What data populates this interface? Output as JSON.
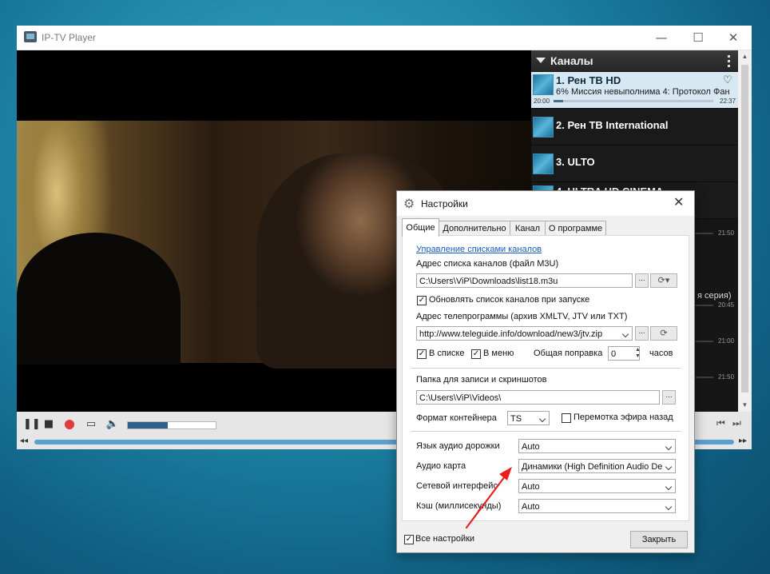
{
  "player": {
    "title": "IP-TV Player",
    "window_buttons": {
      "minimize": "—",
      "maximize": "☐",
      "close": "✕"
    },
    "logo_mark": "4"
  },
  "channels": {
    "header": "Каналы",
    "items": [
      {
        "name": "1. Рен ТВ HD",
        "program": "6% Миссия невыполнима 4: Протокол Фан...",
        "start": "20:00",
        "end": "22:37",
        "progress": 0.06
      },
      {
        "name": "2. Рен ТВ International"
      },
      {
        "name": "3. ULTO"
      },
      {
        "name": "4. ULTRA HD CINEMA"
      }
    ],
    "partial_text": "я серия)",
    "times": [
      "21:50",
      "20:45",
      "21:00",
      "21:50",
      "21:50"
    ]
  },
  "controls": {
    "volume": 0.45,
    "pause_icon": "❚❚",
    "stop_icon": "■",
    "folder_icon": "▭",
    "speaker_icon": "🔈"
  },
  "dialog": {
    "title": "Настройки",
    "tabs": [
      "Общие",
      "Дополнительно",
      "Канал",
      "О программе"
    ],
    "manage_link": "Управление списками каналов",
    "playlist_label": "Адрес списка каналов (файл M3U)",
    "playlist_value": "C:\\Users\\ViP\\Downloads\\list18.m3u",
    "update_on_start": "Обновлять список каналов при запуске",
    "epg_label": "Адрес телепрограммы (архив XMLTV, JTV или TXT)",
    "epg_value": "http://www.teleguide.info/download/new3/jtv.zip",
    "in_list": "В списке",
    "in_menu": "В меню",
    "correction_label": "Общая поправка",
    "correction_value": "0",
    "hours": "часов",
    "record_folder_label": "Папка для записи и скриншотов",
    "record_folder_value": "C:\\Users\\ViP\\Videos\\",
    "container_label": "Формат контейнера",
    "container_value": "TS",
    "timeshift": "Перемотка эфира назад",
    "audio_track_label": "Язык аудио дорожки",
    "audio_track_value": "Auto",
    "audio_card_label": "Аудио карта",
    "audio_card_value": "Динамики (High Definition Audio De",
    "network_label": "Сетевой интерфейс",
    "network_value": "Auto",
    "cache_label": "Кэш (миллисекунды)",
    "cache_value": "Auto",
    "all_settings": "Все настройки",
    "close_button": "Закрыть",
    "browse": "...",
    "check": "✓"
  }
}
